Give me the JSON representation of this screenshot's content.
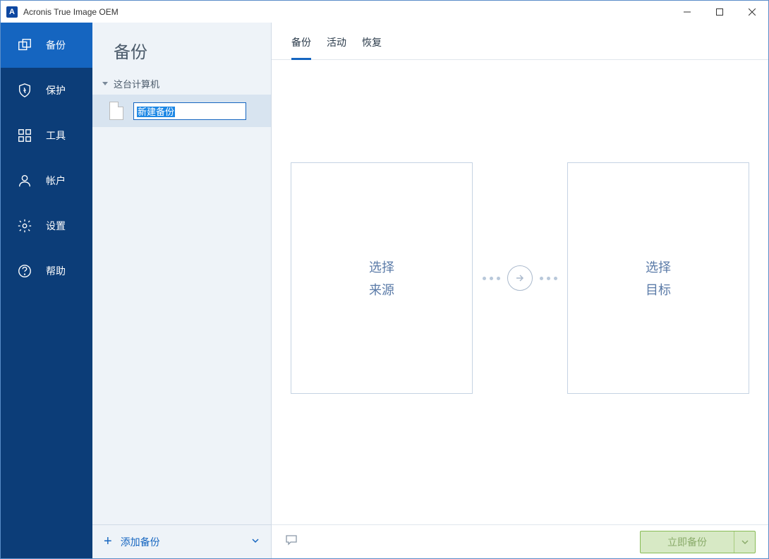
{
  "app": {
    "title": "Acronis True Image OEM",
    "icon_letter": "A"
  },
  "nav": {
    "backup": "备份",
    "protection": "保护",
    "tools": "工具",
    "account": "帐户",
    "settings": "设置",
    "help": "帮助"
  },
  "panel": {
    "title": "备份",
    "this_pc": "这台计算机",
    "new_backup_name": "新建备份",
    "add_backup": "添加备份"
  },
  "tabs": {
    "backup": "备份",
    "activity": "活动",
    "recovery": "恢复"
  },
  "content": {
    "source_line1": "选择",
    "source_line2": "来源",
    "target_line1": "选择",
    "target_line2": "目标"
  },
  "footer": {
    "backup_now": "立即备份"
  }
}
